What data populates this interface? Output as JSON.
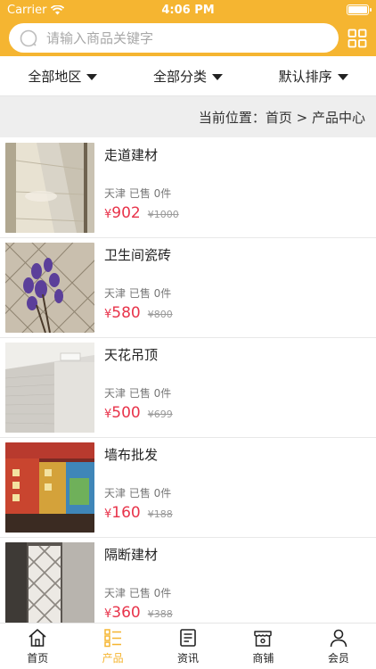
{
  "status": {
    "carrier": "Carrier",
    "time": "4:06 PM"
  },
  "search": {
    "placeholder": "请输入商品关键字"
  },
  "filters": [
    {
      "label": "全部地区"
    },
    {
      "label": "全部分类"
    },
    {
      "label": "默认排序"
    }
  ],
  "breadcrumb": {
    "text": "当前位置：首页 > 产品中心"
  },
  "products": [
    {
      "name": "走道建材",
      "location": "天津",
      "sold": "已售 0件",
      "currency": "¥",
      "price": "902",
      "old_price": "¥1000",
      "image": "tile-hallway"
    },
    {
      "name": "卫生间瓷砖",
      "location": "天津",
      "sold": "已售 0件",
      "currency": "¥",
      "price": "580",
      "old_price": "¥800",
      "image": "bathroom-tile"
    },
    {
      "name": "天花吊顶",
      "location": "天津",
      "sold": "已售 0件",
      "currency": "¥",
      "price": "500",
      "old_price": "¥699",
      "image": "ceiling"
    },
    {
      "name": "墙布批发",
      "location": "天津",
      "sold": "已售 0件",
      "currency": "¥",
      "price": "160",
      "old_price": "¥188",
      "image": "wall-cloth-shop"
    },
    {
      "name": "隔断建材",
      "location": "天津",
      "sold": "已售 0件",
      "currency": "¥",
      "price": "360",
      "old_price": "¥388",
      "image": "partition"
    }
  ],
  "tabbar": [
    {
      "label": "首页",
      "icon": "home-icon",
      "active": false
    },
    {
      "label": "产品",
      "icon": "product-list-icon",
      "active": true
    },
    {
      "label": "资讯",
      "icon": "news-icon",
      "active": false
    },
    {
      "label": "商铺",
      "icon": "shop-icon",
      "active": false
    },
    {
      "label": "会员",
      "icon": "user-icon",
      "active": false
    }
  ],
  "colors": {
    "accent": "#f5b531",
    "price": "#e8334a"
  }
}
